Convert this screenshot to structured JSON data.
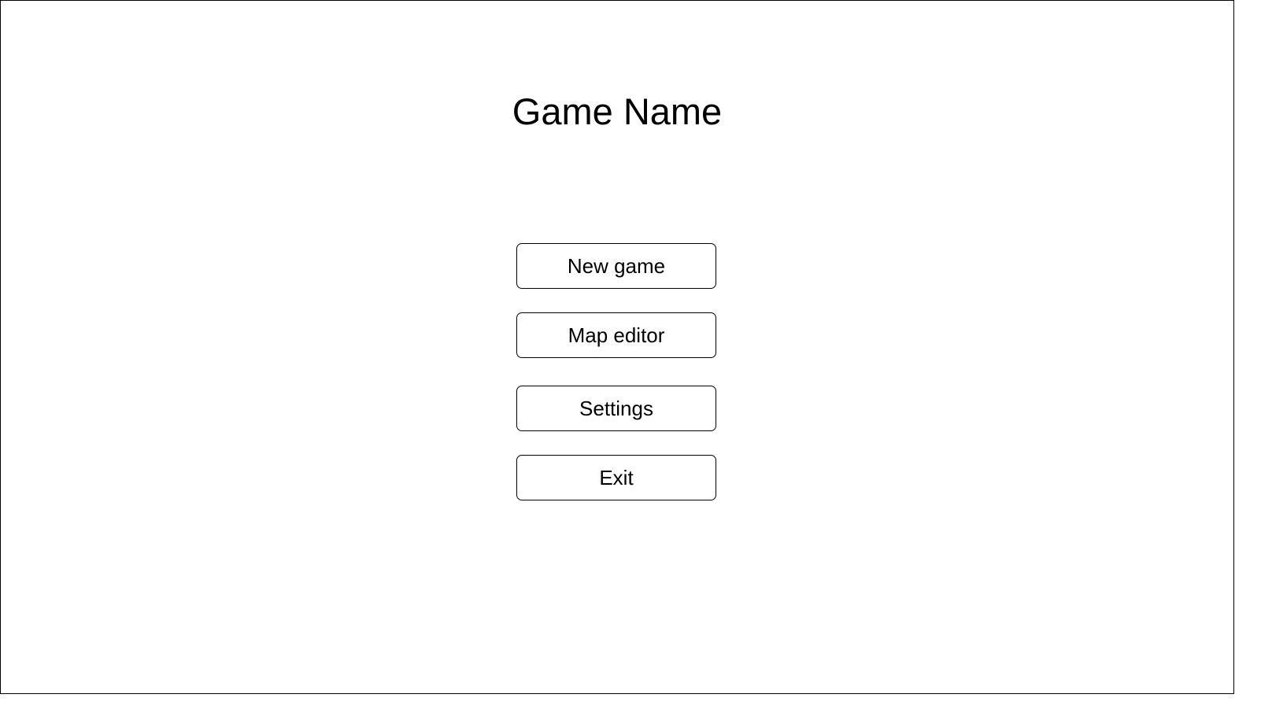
{
  "main_menu": {
    "title": "Game Name",
    "buttons": [
      {
        "label": "New game"
      },
      {
        "label": "Map editor"
      },
      {
        "label": "Settings"
      },
      {
        "label": "Exit"
      }
    ]
  },
  "colors": {
    "background": "#ffffff",
    "border": "#000000",
    "text": "#000000"
  }
}
